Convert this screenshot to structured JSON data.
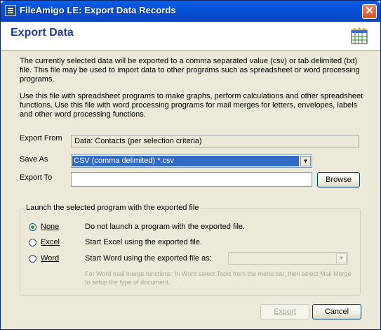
{
  "window": {
    "title": "FileAmigo LE: Export Data Records",
    "close_glyph": "✕"
  },
  "header": {
    "title": "Export Data"
  },
  "description": {
    "p1": "The currently selected data will be exported to a comma separated value (csv) or tab delimited (txt) file. This file may be used to import data to other programs such as spreadsheet or word processing programs.",
    "p2": "Use this file with spreadsheet programs to make graphs, perform calculations and other spreadsheet functions. Use this file with word processing programs for mail merges for letters, envelopes, labels and other word processing functions."
  },
  "form": {
    "export_from_label": "Export From",
    "export_from_value": "Data: Contacts (per selection criteria)",
    "save_as_label": "Save As",
    "save_as_value": "CSV (comma delimited) *.csv",
    "export_to_label": "Export To",
    "export_to_value": "",
    "browse_label": "Browse"
  },
  "launch_group": {
    "title": "Launch the selected program with the exported file",
    "options": [
      {
        "label": "None",
        "description": "Do not launch a program with the exported file.",
        "selected": true
      },
      {
        "label": "Excel",
        "description": "Start Excel using the exported file.",
        "selected": false
      },
      {
        "label": "Word",
        "description": "Start Word using the exported file as:",
        "selected": false
      }
    ],
    "word_doc_type_value": "",
    "note": "For Word mail merge functions: In Word select Tools from the menu bar, then select Mail Merge to setup the type of document."
  },
  "buttons": {
    "export_label": "Export",
    "cancel_label": "Cancel"
  },
  "colors": {
    "title_bar": "#0552d6",
    "header_title": "#1c3c9e",
    "selection": "#316ac5",
    "dialog_bg": "#ece9d8"
  },
  "icons": {
    "app": "app-icon",
    "header": "calendar-grid-icon",
    "close": "close-icon"
  }
}
